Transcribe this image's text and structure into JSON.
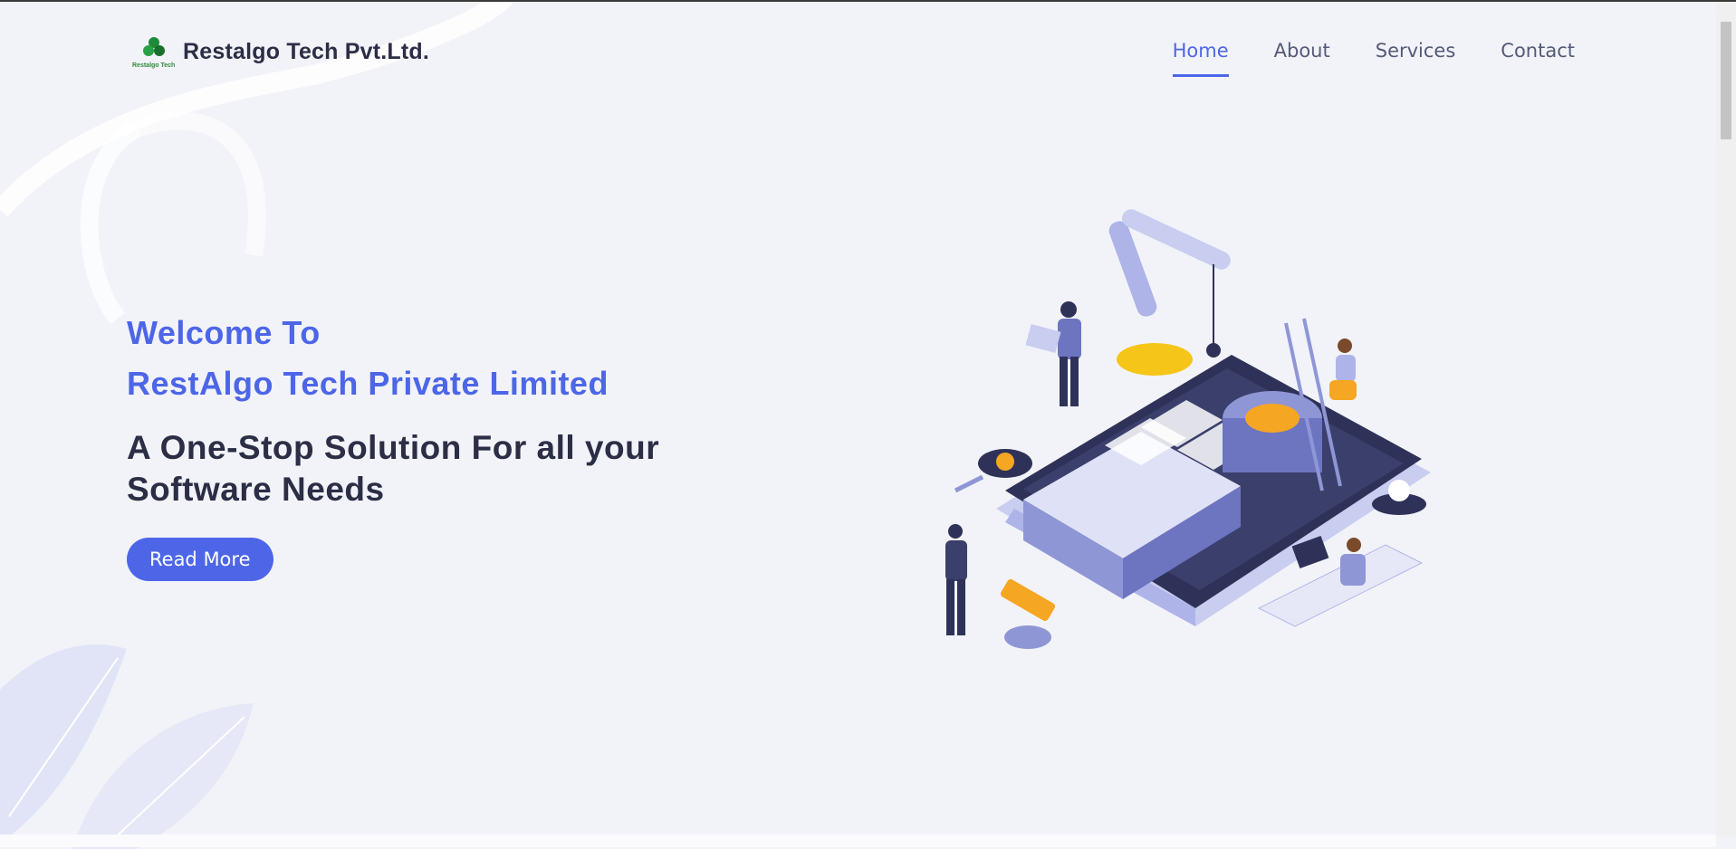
{
  "brand": {
    "logo_text": "Restalgo Tech",
    "name": "Restalgo Tech Pvt.Ltd."
  },
  "nav": {
    "items": [
      "Home",
      "About",
      "Services",
      "Contact"
    ],
    "active": "Home"
  },
  "hero": {
    "welcome_line1": "Welcome To",
    "welcome_line2": "RestAlgo Tech Private Limited",
    "tagline_line1": "A One-Stop Solution For all your",
    "tagline_line2": "Software Needs",
    "button_label": "Read More"
  },
  "colors": {
    "accent": "#4d66e8",
    "text_dark": "#2b2e45",
    "background": "#f2f3f9",
    "illustration_orange": "#f5a623",
    "illustration_navy": "#2f3258",
    "illustration_lavender": "#aeb4e8"
  },
  "icons": [
    "logo-clover-icon",
    "isometric-illustration"
  ]
}
